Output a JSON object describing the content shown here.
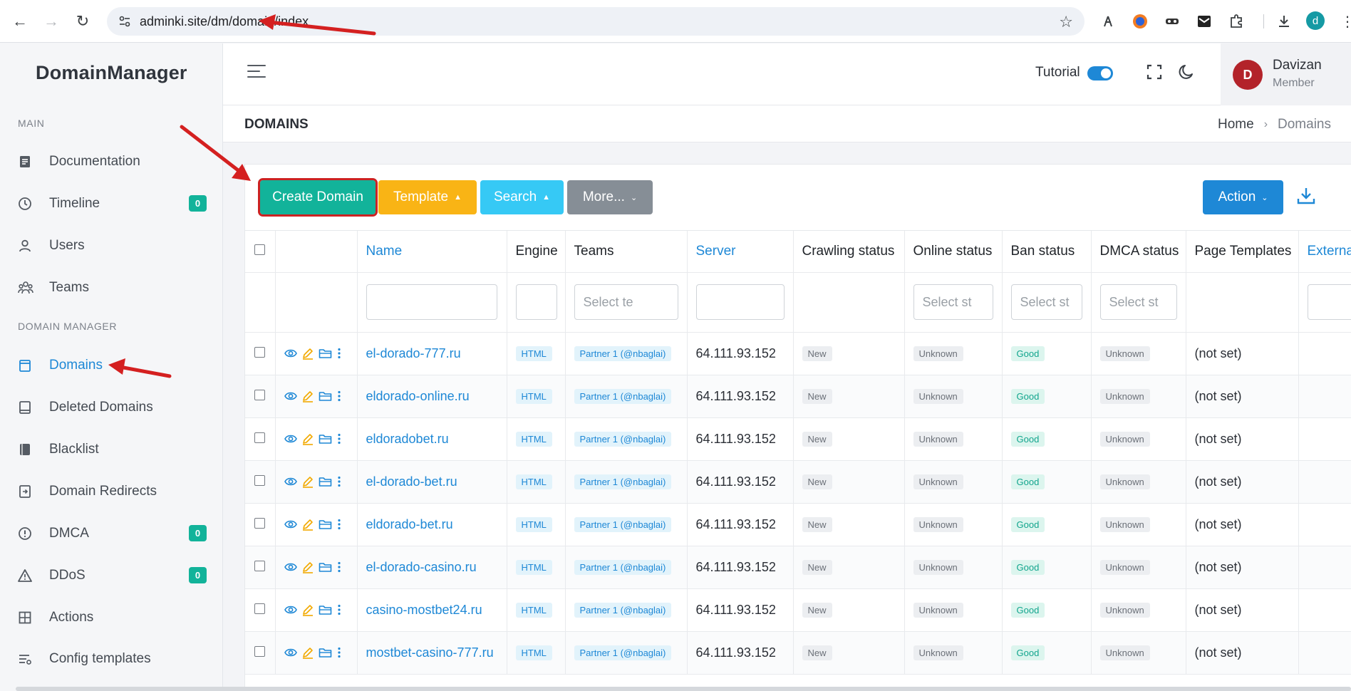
{
  "browser": {
    "url": "adminki.site/dm/domain/index",
    "profile_initial": "d"
  },
  "sidebar": {
    "brand": "DomainManager",
    "sections": [
      {
        "label": "MAIN",
        "items": [
          {
            "label": "Documentation",
            "icon": "document-icon"
          },
          {
            "label": "Timeline",
            "icon": "clock-icon",
            "badge": "0"
          },
          {
            "label": "Users",
            "icon": "user-icon"
          },
          {
            "label": "Teams",
            "icon": "team-icon"
          }
        ]
      },
      {
        "label": "DOMAIN MANAGER",
        "items": [
          {
            "label": "Domains",
            "icon": "domains-icon",
            "active": true
          },
          {
            "label": "Deleted Domains",
            "icon": "book-icon"
          },
          {
            "label": "Blacklist",
            "icon": "blacklist-icon"
          },
          {
            "label": "Domain Redirects",
            "icon": "redirect-icon"
          },
          {
            "label": "DMCA",
            "icon": "alert-circle-icon",
            "badge": "0"
          },
          {
            "label": "DDoS",
            "icon": "warning-triangle-icon",
            "badge": "0"
          },
          {
            "label": "Actions",
            "icon": "grid-icon"
          },
          {
            "label": "Config templates",
            "icon": "config-icon"
          }
        ]
      }
    ]
  },
  "header": {
    "tutorial_label": "Tutorial",
    "tutorial_on": true,
    "user": {
      "initial": "D",
      "name": "Davizan",
      "role": "Member"
    }
  },
  "page": {
    "title": "DOMAINS",
    "breadcrumb": [
      "Home",
      "Domains"
    ]
  },
  "toolbar": {
    "create_label": "Create Domain",
    "template_label": "Template",
    "search_label": "Search",
    "more_label": "More...",
    "action_label": "Action"
  },
  "table": {
    "columns": [
      "Name",
      "Engine",
      "Teams",
      "Server",
      "Crawling status",
      "Online status",
      "Ban status",
      "DMCA status",
      "Page Templates",
      "Externa"
    ],
    "filters": {
      "teams_placeholder": "Select te",
      "online_placeholder": "Select st",
      "ban_placeholder": "Select st",
      "dmca_placeholder": "Select st"
    },
    "rows": [
      {
        "name": "el-dorado-777.ru",
        "engine": "HTML",
        "team": "Partner 1 (@nbaglai)",
        "server": "64.111.93.152",
        "crawling": "New",
        "online": "Unknown",
        "ban": "Good",
        "dmca": "Unknown",
        "templates": "(not set)"
      },
      {
        "name": "eldorado-online.ru",
        "engine": "HTML",
        "team": "Partner 1 (@nbaglai)",
        "server": "64.111.93.152",
        "crawling": "New",
        "online": "Unknown",
        "ban": "Good",
        "dmca": "Unknown",
        "templates": "(not set)"
      },
      {
        "name": "eldoradobet.ru",
        "engine": "HTML",
        "team": "Partner 1 (@nbaglai)",
        "server": "64.111.93.152",
        "crawling": "New",
        "online": "Unknown",
        "ban": "Good",
        "dmca": "Unknown",
        "templates": "(not set)"
      },
      {
        "name": "el-dorado-bet.ru",
        "engine": "HTML",
        "team": "Partner 1 (@nbaglai)",
        "server": "64.111.93.152",
        "crawling": "New",
        "online": "Unknown",
        "ban": "Good",
        "dmca": "Unknown",
        "templates": "(not set)"
      },
      {
        "name": "eldorado-bet.ru",
        "engine": "HTML",
        "team": "Partner 1 (@nbaglai)",
        "server": "64.111.93.152",
        "crawling": "New",
        "online": "Unknown",
        "ban": "Good",
        "dmca": "Unknown",
        "templates": "(not set)"
      },
      {
        "name": "el-dorado-casino.ru",
        "engine": "HTML",
        "team": "Partner 1 (@nbaglai)",
        "server": "64.111.93.152",
        "crawling": "New",
        "online": "Unknown",
        "ban": "Good",
        "dmca": "Unknown",
        "templates": "(not set)"
      },
      {
        "name": "casino-mostbet24.ru",
        "engine": "HTML",
        "team": "Partner 1 (@nbaglai)",
        "server": "64.111.93.152",
        "crawling": "New",
        "online": "Unknown",
        "ban": "Good",
        "dmca": "Unknown",
        "templates": "(not set)"
      },
      {
        "name": "mostbet-casino-777.ru",
        "engine": "HTML",
        "team": "Partner 1 (@nbaglai)",
        "server": "64.111.93.152",
        "crawling": "New",
        "online": "Unknown",
        "ban": "Good",
        "dmca": "Unknown",
        "templates": "(not set)"
      }
    ]
  },
  "colors": {
    "accent": "#1e88d6",
    "create": "#12b39a",
    "template": "#f9b415",
    "search": "#36c9f5",
    "more": "#868e96",
    "annotation_arrow": "#d42020"
  }
}
